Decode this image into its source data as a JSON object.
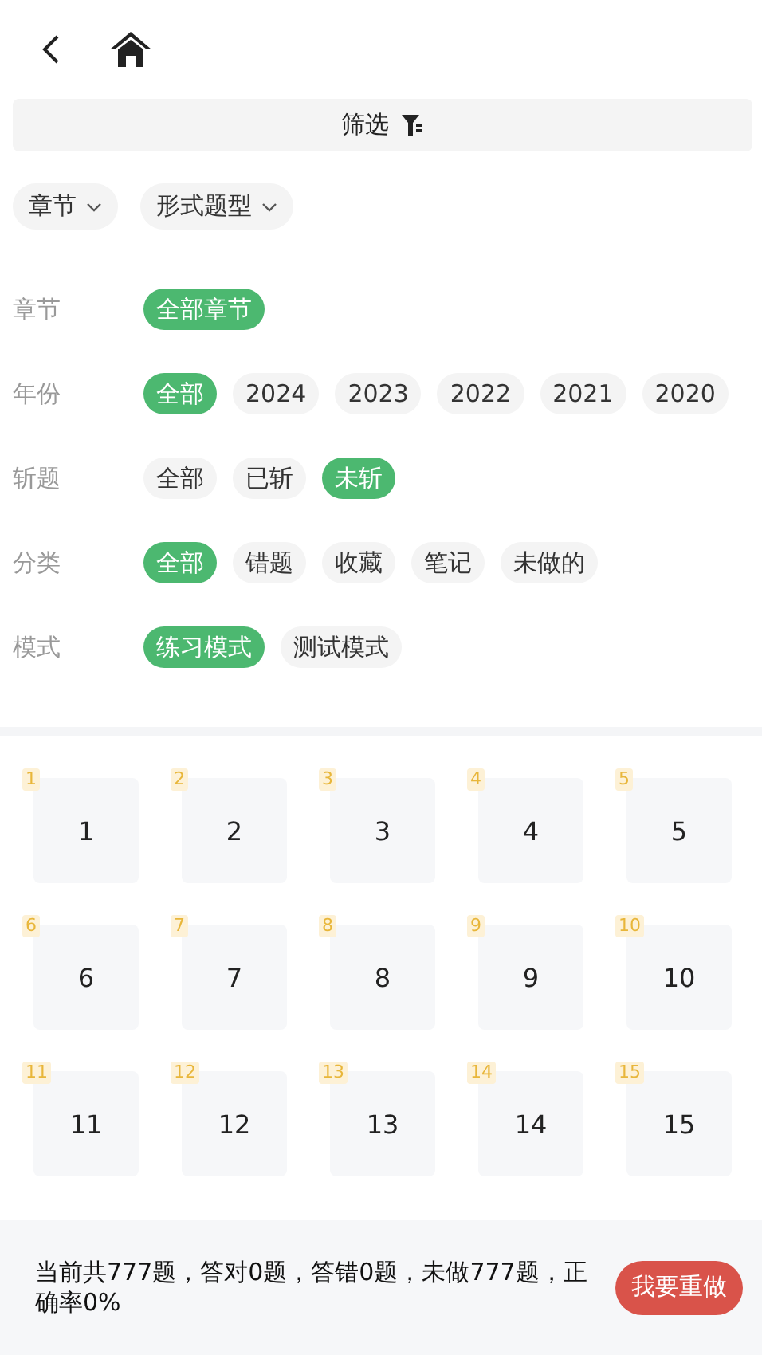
{
  "filter_bar": {
    "label": "筛选"
  },
  "dropdowns": [
    {
      "label": "章节"
    },
    {
      "label": "形式题型"
    }
  ],
  "filters": [
    {
      "label": "章节",
      "options": [
        {
          "label": "全部章节",
          "selected": true
        }
      ]
    },
    {
      "label": "年份",
      "options": [
        {
          "label": "全部",
          "selected": true
        },
        {
          "label": "2024",
          "selected": false
        },
        {
          "label": "2023",
          "selected": false
        },
        {
          "label": "2022",
          "selected": false
        },
        {
          "label": "2021",
          "selected": false
        },
        {
          "label": "2020",
          "selected": false
        }
      ]
    },
    {
      "label": "斩题",
      "options": [
        {
          "label": "全部",
          "selected": false
        },
        {
          "label": "已斩",
          "selected": false
        },
        {
          "label": "未斩",
          "selected": true
        }
      ]
    },
    {
      "label": "分类",
      "options": [
        {
          "label": "全部",
          "selected": true
        },
        {
          "label": "错题",
          "selected": false
        },
        {
          "label": "收藏",
          "selected": false
        },
        {
          "label": "笔记",
          "selected": false
        },
        {
          "label": "未做的",
          "selected": false
        }
      ]
    },
    {
      "label": "模式",
      "options": [
        {
          "label": "练习模式",
          "selected": true
        },
        {
          "label": "测试模式",
          "selected": false
        }
      ]
    }
  ],
  "questions": [
    {
      "badge": "1",
      "number": "1"
    },
    {
      "badge": "2",
      "number": "2"
    },
    {
      "badge": "3",
      "number": "3"
    },
    {
      "badge": "4",
      "number": "4"
    },
    {
      "badge": "5",
      "number": "5"
    },
    {
      "badge": "6",
      "number": "6"
    },
    {
      "badge": "7",
      "number": "7"
    },
    {
      "badge": "8",
      "number": "8"
    },
    {
      "badge": "9",
      "number": "9"
    },
    {
      "badge": "10",
      "number": "10"
    },
    {
      "badge": "11",
      "number": "11"
    },
    {
      "badge": "12",
      "number": "12"
    },
    {
      "badge": "13",
      "number": "13"
    },
    {
      "badge": "14",
      "number": "14"
    },
    {
      "badge": "15",
      "number": "15"
    }
  ],
  "summary": "当前共777题，答对0题，答错0题，未做777题，正确率0%",
  "redo_button": "我要重做"
}
